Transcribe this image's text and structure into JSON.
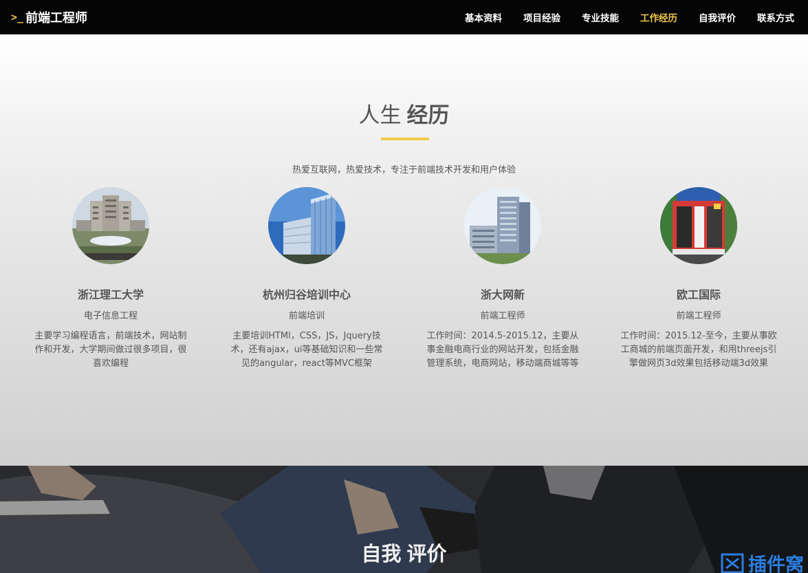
{
  "header": {
    "brand_prompt": ">_",
    "brand_text": "前端工程师",
    "nav": [
      {
        "label": "基本资料",
        "active": false
      },
      {
        "label": "项目经验",
        "active": false
      },
      {
        "label": "专业技能",
        "active": false
      },
      {
        "label": "工作经历",
        "active": true
      },
      {
        "label": "自我评价",
        "active": false
      },
      {
        "label": "联系方式",
        "active": false
      }
    ]
  },
  "timeline": {
    "title_light": "人生",
    "title_bold": "经历",
    "subtitle": "热爱互联网，热爱技术，专注于前端技术开发和用户体验",
    "cards": [
      {
        "name": "浙江理工大学",
        "role": "电子信息工程",
        "desc": "主要学习编程语言，前端技术，网站制作和开发，大学期间做过很多项目，很喜欢编程",
        "image_icon": "university-building-icon"
      },
      {
        "name": "杭州归谷培训中心",
        "role": "前端培训",
        "desc": "主要培训HTMl，CSS，JS，Jquery技术，还有ajax，ui等基础知识和一些常见的angular，react等MVC框架",
        "image_icon": "office-tower-icon"
      },
      {
        "name": "浙大网新",
        "role": "前端工程师",
        "desc": "工作时间：2014.5-2015.12，主要从事金融电商行业的网站开发，包括金融管理系统，电商网站，移动端商城等等",
        "image_icon": "office-building-icon"
      },
      {
        "name": "欧工国际",
        "role": "前端工程师",
        "desc": "工作时间：2015.12-至今，主要从事欧工商城的前端页面开发，和用threejs引擎做网页3d效果包括移动端3d效果",
        "image_icon": "storefront-icon"
      }
    ]
  },
  "self_eval": {
    "title_light": "自我",
    "title_bold": "评价"
  },
  "watermark": {
    "text": "插件窝"
  },
  "colors": {
    "accent": "#f2c94c",
    "navbar_bg": "#050505",
    "watermark": "#2a7de1"
  }
}
